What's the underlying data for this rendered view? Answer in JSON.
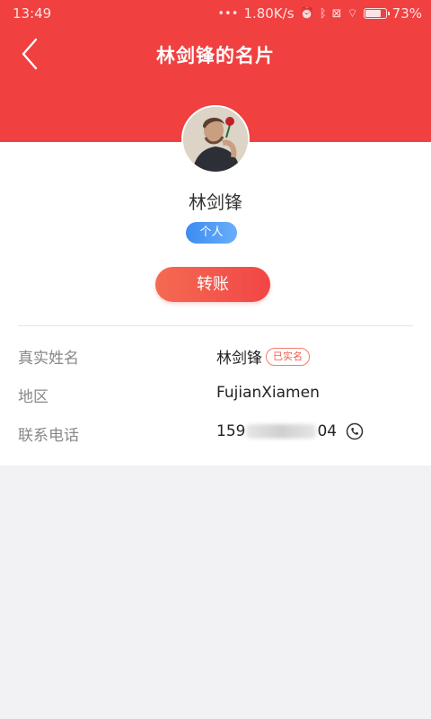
{
  "status_bar": {
    "time": "13:49",
    "speed": "1.80K/s",
    "battery": "73%",
    "battery_level": 0.73
  },
  "header": {
    "title": "林剑锋的名片",
    "background": "#f04040"
  },
  "profile": {
    "name": "林剑锋",
    "type_badge": "个人",
    "transfer_label": "转账"
  },
  "info": {
    "real_name_label": "真实姓名",
    "real_name_value": "林剑锋",
    "verified_badge": "已实名",
    "region_label": "地区",
    "region_value": "FujianXiamen",
    "phone_label": "联系电话",
    "phone_prefix": "159",
    "phone_suffix": "04"
  },
  "icons": {
    "back": "back-arrow-icon",
    "phone": "phone-icon"
  }
}
